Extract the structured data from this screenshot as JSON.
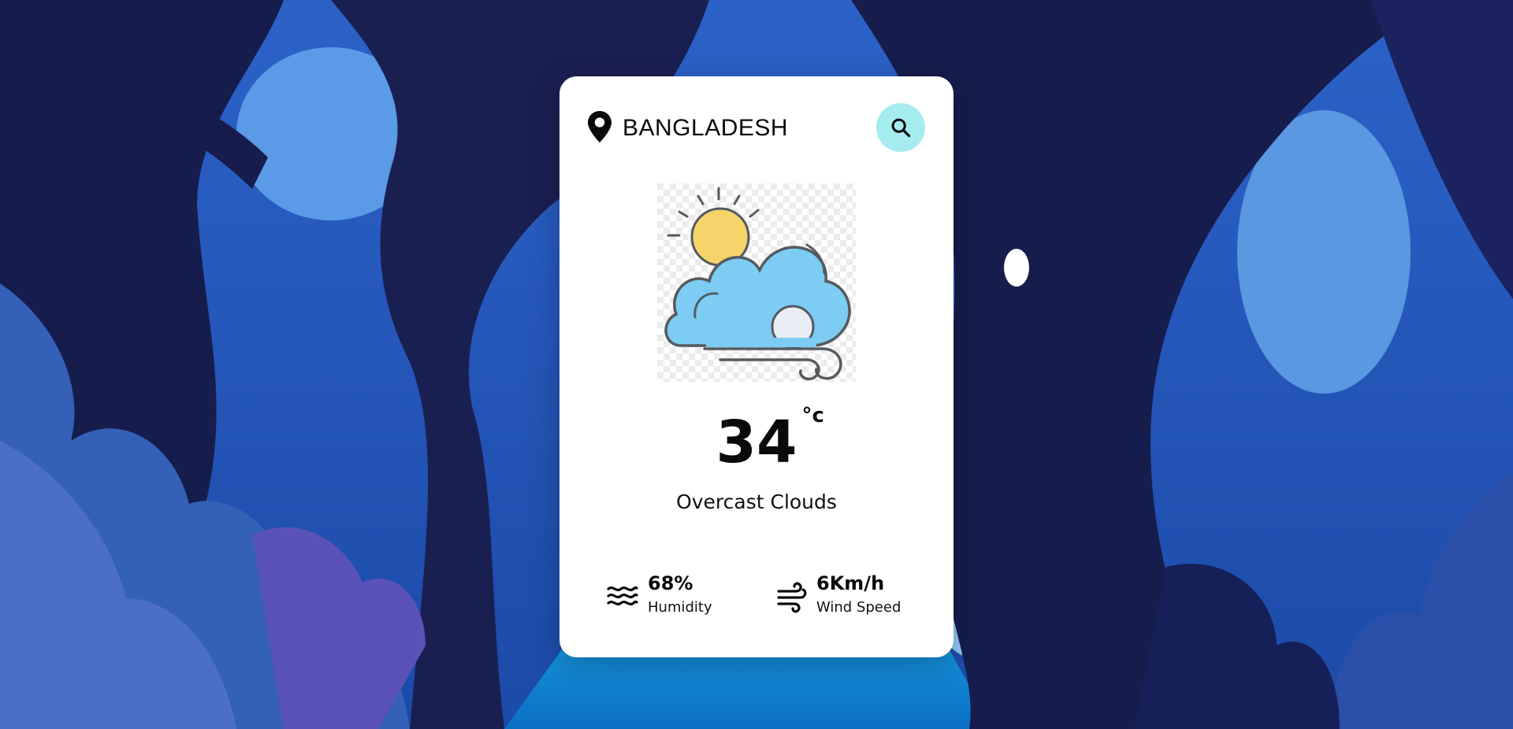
{
  "search": {
    "value": "BANGLADESH",
    "location_icon": "map-pin-icon",
    "button_icon": "search-icon"
  },
  "weather": {
    "icon": "partly-cloudy-windy-icon",
    "temperature": "34",
    "unit": "°c",
    "description": "Overcast Clouds"
  },
  "details": {
    "humidity": {
      "value": "68%",
      "label": "Humidity",
      "icon": "waves-icon"
    },
    "wind": {
      "value": "6Km/h",
      "label": "Wind Speed",
      "icon": "wind-icon"
    }
  },
  "colors": {
    "search_button": "#a4ecf0",
    "background": "#152a6b",
    "card": "#ffffff"
  }
}
